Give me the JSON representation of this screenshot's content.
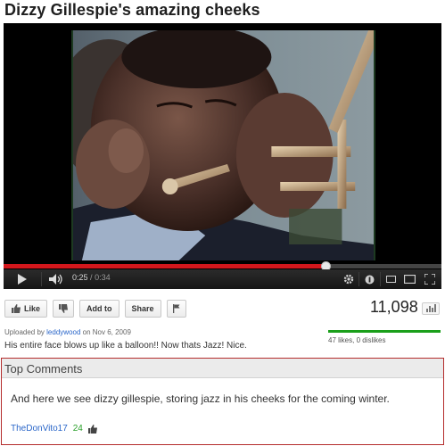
{
  "video": {
    "title": "Dizzy Gillespie's amazing cheeks",
    "time_current": "0:25",
    "time_duration": "0:34",
    "progress_fraction": 0.735
  },
  "actions": {
    "like_label": "Like",
    "add_to_label": "Add to",
    "share_label": "Share"
  },
  "stats": {
    "views": "11,098",
    "likes_dislikes": "47 likes, 0 dislikes"
  },
  "upload": {
    "prefix": "Uploaded by",
    "user": "leddywood",
    "date": "on Nov 6, 2009",
    "description": "His entire face blows up like a balloon!! Now thats Jazz! Nice."
  },
  "comments": {
    "header": "Top Comments",
    "items": [
      {
        "text": "And here we see dizzy gillespie, storing jazz in his cheeks for the coming winter.",
        "user": "TheDonVito17",
        "likes": "24"
      }
    ]
  },
  "colors": {
    "progress": "#d3171c",
    "link": "#2a66c9",
    "like_bar": "#1a9f1a",
    "comment_border": "#b42c2c"
  }
}
